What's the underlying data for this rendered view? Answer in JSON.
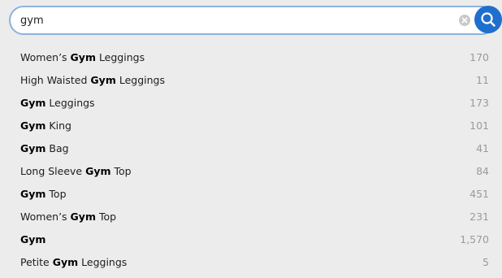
{
  "search": {
    "value": "gym",
    "clear_icon": "clear-icon",
    "search_icon": "magnifier-icon",
    "accent_color": "#1f6fcd"
  },
  "suggestions": [
    {
      "before": "Women’s ",
      "match": "Gym",
      "after": " Leggings",
      "count": "170"
    },
    {
      "before": "High Waisted ",
      "match": "Gym",
      "after": " Leggings",
      "count": "11"
    },
    {
      "before": "",
      "match": "Gym",
      "after": " Leggings",
      "count": "173"
    },
    {
      "before": "",
      "match": "Gym",
      "after": " King",
      "count": "101"
    },
    {
      "before": "",
      "match": "Gym",
      "after": " Bag",
      "count": "41"
    },
    {
      "before": "Long Sleeve ",
      "match": "Gym",
      "after": " Top",
      "count": "84"
    },
    {
      "before": "",
      "match": "Gym",
      "after": " Top",
      "count": "451"
    },
    {
      "before": "Women’s ",
      "match": "Gym",
      "after": " Top",
      "count": "231"
    },
    {
      "before": "",
      "match": "Gym",
      "after": "",
      "count": "1,570"
    },
    {
      "before": "Petite ",
      "match": "Gym",
      "after": " Leggings",
      "count": "5"
    }
  ]
}
